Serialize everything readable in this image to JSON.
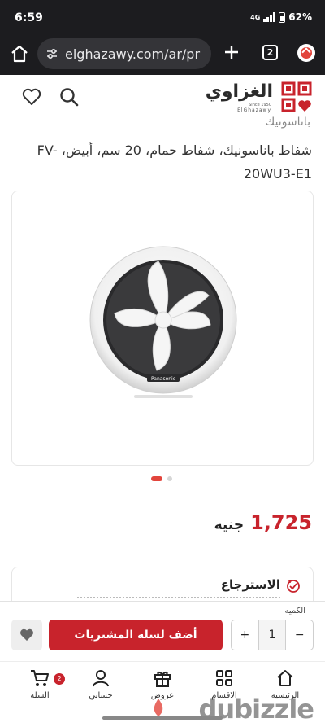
{
  "status_bar": {
    "time": "6:59",
    "network": "4G",
    "battery": "62%"
  },
  "browser": {
    "url": "elghazawy.com/ar/pr",
    "tab_count": "2"
  },
  "site": {
    "logo_text": "الغزاوي",
    "logo_since": "Since 1950",
    "logo_sub": "ElGhazawy"
  },
  "product": {
    "brand": "باناسونيك",
    "title": "شفاط باناسونيك، شفاط حمام، 20 سم، أبيض، FV-20WU3-E1",
    "price_value": "1,725",
    "price_currency": "جنيه",
    "carousel": {
      "count": 2,
      "active": 1
    }
  },
  "return_policy": {
    "title": "الاسترجاع"
  },
  "buy_bar": {
    "quantity_label": "الكميه",
    "quantity": "1",
    "minus": "−",
    "plus": "+",
    "add_to_cart": "أضف لسلة المشتريات"
  },
  "bottom_nav": {
    "cart_badge": "2",
    "items": [
      "السله",
      "حسابي",
      "عروض",
      "الاقسام",
      "الرئيسية"
    ]
  },
  "watermark": "dubizzle",
  "colors": {
    "accent": "#c8232c",
    "dark_bar": "#1c1c1f"
  }
}
